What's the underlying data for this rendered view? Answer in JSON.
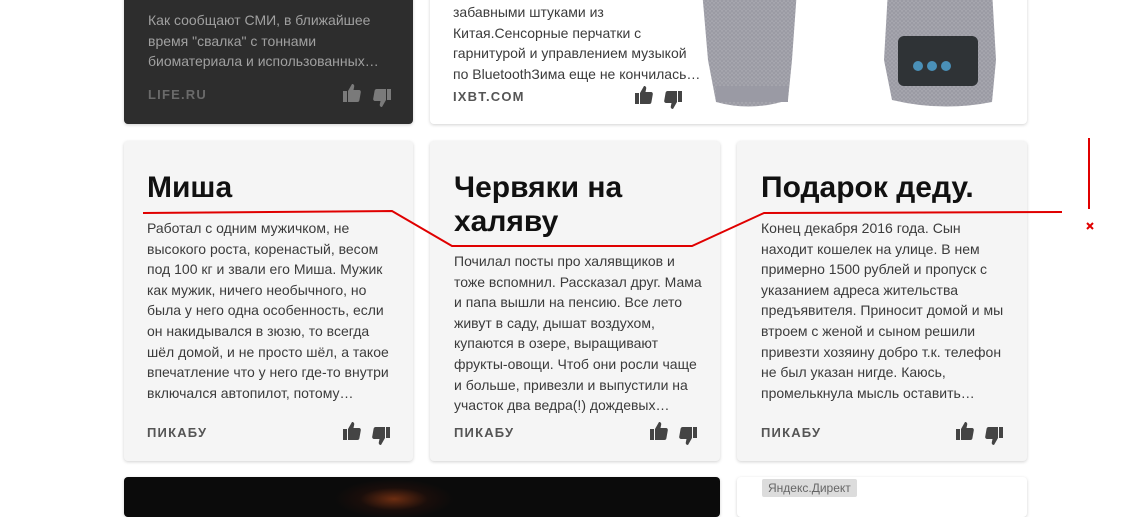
{
  "cards": {
    "life": {
      "text": "Как сообщают СМИ, в ближайшее время \"свалка\" с тоннами биоматериала и использованных…",
      "source": "LIFE.RU"
    },
    "ixbt": {
      "text": "забавными штуками из Китая.Сенсорные перчатки с гарнитурой и управлением музыкой по BluetoothЗима еще не кончилась…",
      "source": "IXBT.COM"
    },
    "misha": {
      "title": "Миша",
      "text": "Работал с одним мужичком, не высокого роста, коренастый, весом под 100 кг и звали его Миша. Мужик как мужик, ничего необычного, но была у него одна особенность, если он накидывался в зюзю, то всегда шёл домой, и не просто шёл, а такое впечатление что у него где-то внутри включался автопилот, потому…",
      "source": "ПИКАБУ"
    },
    "worms": {
      "title": "Червяки на халяву",
      "text": "Почилал посты про халявщиков и тоже вспомнил. Рассказал друг. Мама и папа вышли на пенсию. Все лето живут в саду, дышат воздухом, купаются в озере, выращивают фрукты-овощи. Чтоб они росли чаще и больше, привезли и выпустили на участок два ведра(!) дождевых…",
      "source": "ПИКАБУ"
    },
    "gift": {
      "title": "Подарок деду.",
      "text": "Конец декабря 2016 года. Сын находит кошелек на улице. В нем примерно 1500 рублей и пропуск с указанием адреса жительства предъявителя. Приносит домой и мы втроем с женой и сыном решили привезти хозяину добро т.к. телефон не был указан нигде. Каюсь, промелькнула мысль оставить…",
      "source": "ПИКАБУ"
    },
    "direct": {
      "badge": "Яндекс.Директ"
    }
  },
  "icons": {
    "like": "thumb-up-icon",
    "dislike": "thumb-down-icon"
  },
  "colors": {
    "annotation": "#e00000",
    "card_bg": "#f5f5f5",
    "dark_card_bg": "#2d2d2d"
  }
}
